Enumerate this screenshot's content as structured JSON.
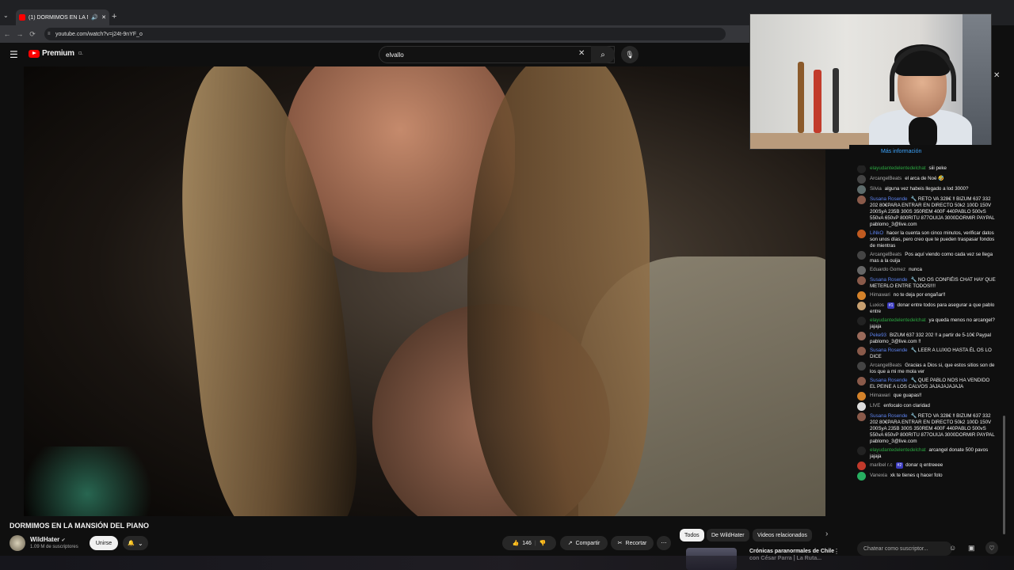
{
  "browser": {
    "tab_title": "(1) DORMIMOS EN LA MA...",
    "url": "youtube.com/watch?v=j24t-9nYF_o",
    "new_tab": "+",
    "tab_menu": "⌄",
    "back": "←",
    "forward": "→",
    "reload": "⟳",
    "url_lock": "≡"
  },
  "header": {
    "menu_icon": "☰",
    "logo_text": "Premium",
    "logo_country": "CL",
    "search_value": "elvallo",
    "clear_icon": "✕",
    "search_icon": "⌕",
    "mic_icon": "🎙"
  },
  "video": {
    "title": "DORMIMOS EN LA MANSIÓN DEL PIANO",
    "channel": "WildHater",
    "verified": "✔",
    "subscribers": "1.09 M de suscriptores",
    "join_label": "Unirse",
    "bell_icon": "🔔",
    "bell_caret": "⌄",
    "like_count": "146",
    "like_icon": "👍",
    "dislike_icon": "👎",
    "share_label": "Compartir",
    "share_icon": "↗",
    "clip_label": "Recortar",
    "clip_icon": "✂",
    "more_icon": "⋯"
  },
  "chips": [
    "Todos",
    "De WildHater",
    "Videos relacionados"
  ],
  "chip_next_icon": "›",
  "recommended": {
    "title": "Crónicas paranormales de Chile con César Parra | La Ruta...",
    "more_icon": "⋮"
  },
  "chat": {
    "more_info": "Más información",
    "close_icon": "✕",
    "input_placeholder": "Chatear como suscriptor...",
    "emoji_icon": "☺",
    "gift_icon": "▣",
    "heart_icon": "♡",
    "messages": [
      {
        "author": "elayudantedelentedelchat",
        "type": "mem",
        "text": "siii peke",
        "avatar": "#222222"
      },
      {
        "author": "ArcangelBeats",
        "type": "",
        "text": "el arca de Noé 🤣",
        "avatar": "#444444"
      },
      {
        "author": "Silvia",
        "type": "",
        "text": "alguna vez habeis llegado a lod 3000?",
        "avatar": "#5d6b6b"
      },
      {
        "author": "Susana Rosende",
        "type": "mod",
        "text": "🔧 RETO VA 328€ ‼ BIZUM 637 332 202 80€PARA ENTRAR EN DIRECTO 50k2 100D 150V 200SyA 235B 300S 350REM 400F 440PABLO 500vS 550vA 650vP 800RITU 877OUIJA 3000DORMIR PAYPAL pablomo_3@live.com",
        "avatar": "#8a5a4a"
      },
      {
        "author": "LiNkO",
        "type": "mod",
        "text": "hacer la cuenta son cinco minutos, verificar datos son unos días, pero creo que te pueden traspasar fondos de mientras",
        "avatar": "#c05a20"
      },
      {
        "author": "ArcangelBeats",
        "type": "",
        "text": "Pos aquí viendo como cada vez se llega mas a la ouija",
        "avatar": "#444444"
      },
      {
        "author": "Eduardo Gomez",
        "type": "",
        "text": "nunca",
        "avatar": "#666666"
      },
      {
        "author": "Susana Rosende",
        "type": "mod",
        "text": "🔧 NO OS CONFIÉIS CHAT HAY QUE METERLO ENTRE TODOS!!!!",
        "avatar": "#8a5a4a"
      },
      {
        "author": "Himawari",
        "type": "",
        "text": "no te deja por engañar!!",
        "avatar": "#d4822a"
      },
      {
        "author": "Luxios",
        "type": "",
        "badge": "#1",
        "text": "donar entre todos para asegurar a que pablo entre",
        "avatar": "#c8a070"
      },
      {
        "author": "elayudantedelentedelchat",
        "type": "mem",
        "text": "ya queda menos no arcangel? jajaja",
        "avatar": "#222222"
      },
      {
        "author": "Peke93",
        "type": "mod",
        "text": "BIZUM 637 332 202 ‼ a partir de 5-10€ Paypal pablomo_3@live.com ‼",
        "avatar": "#9a6a5a"
      },
      {
        "author": "Susana Rosende",
        "type": "mod",
        "text": "🔧 LEER A LUXIO HASTA ÉL OS LO DICE",
        "avatar": "#8a5a4a"
      },
      {
        "author": "ArcangelBeats",
        "type": "",
        "text": "Gracias a Dios si, que estos sitios son de los que a mi me mola ver",
        "avatar": "#444444"
      },
      {
        "author": "Susana Rosende",
        "type": "mod",
        "text": "🔧 QUE PABLO NOS HA VENDIDO EL PEINE A LOS CALVOS JAJAJAJAJAJA",
        "avatar": "#8a5a4a"
      },
      {
        "author": "Himawari",
        "type": "",
        "text": "que guapas!!",
        "avatar": "#d4822a"
      },
      {
        "author": "LIVE",
        "type": "",
        "text": "enfocalo con claridad",
        "avatar": "#dddddd"
      },
      {
        "author": "Susana Rosende",
        "type": "mod",
        "text": "🔧 RETO VA 328€ ‼ BIZUM 637 332 202 80€PARA ENTRAR EN DIRECTO 50k2 100D 150V 200SyA 235B 300S 350REM 400F 440PABLO 500vS 550vA 650vP 800RITU 877OUIJA 3000DORMIR PAYPAL pablomo_3@live.com",
        "avatar": "#8a5a4a"
      },
      {
        "author": "elayudantedelentedelchat",
        "type": "mem",
        "text": "arcangel donate 500 pavos jajaja",
        "avatar": "#222222"
      },
      {
        "author": "maribel r.c",
        "type": "",
        "badge": "#2",
        "text": "donar q entreeee",
        "avatar": "#c0392b"
      },
      {
        "author": "Vanexia",
        "type": "",
        "text": "xk te tienes q hacer foto",
        "avatar": "#27ae60"
      }
    ]
  }
}
